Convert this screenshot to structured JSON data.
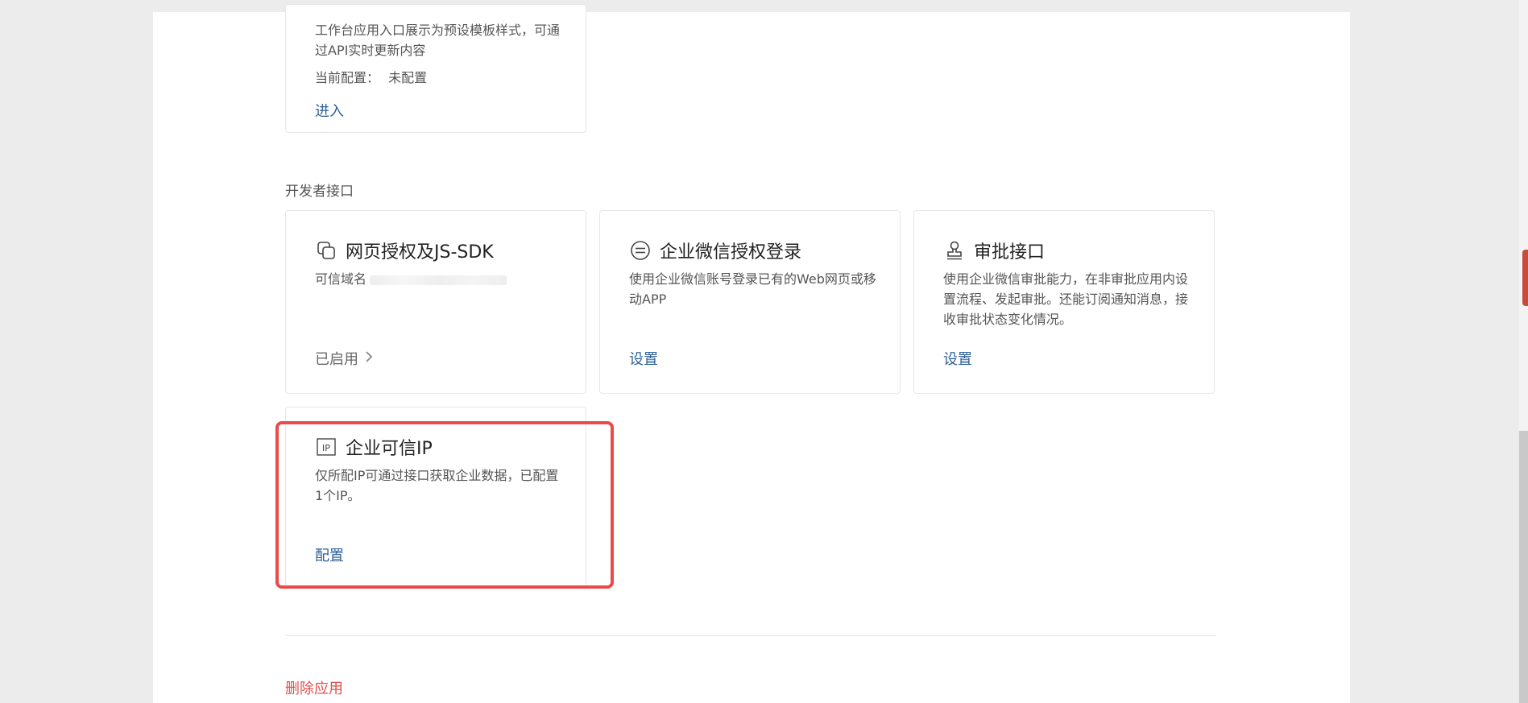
{
  "top_card": {
    "desc": "工作台应用入口展示为预设模板样式，可通过API实时更新内容",
    "config_label": "当前配置：",
    "config_value": "未配置",
    "action": "进入"
  },
  "section_title": "开发者接口",
  "cards": [
    {
      "title": "网页授权及JS-SDK",
      "icon": "copy-icon",
      "desc": "可信域名",
      "action": "已启用",
      "action_icon": "chevron-right-icon"
    },
    {
      "title": "企业微信授权登录",
      "icon": "equal-circle-icon",
      "desc": "使用企业微信账号登录已有的Web网页或移动APP",
      "action": "设置"
    },
    {
      "title": "审批接口",
      "icon": "stamp-icon",
      "desc": "使用企业微信审批能力，在非审批应用内设置流程、发起审批。还能订阅通知消息，接收审批状态变化情况。",
      "action": "设置"
    },
    {
      "title": "企业可信IP",
      "icon": "ip-icon",
      "desc": "仅所配IP可通过接口获取企业数据，已配置1个IP。",
      "action": "配置"
    }
  ],
  "delete_link": "删除应用",
  "colors": {
    "link": "#2c5f96",
    "danger": "#e0504d",
    "highlight": "#e94b4b",
    "border": "#e4e6ea"
  }
}
